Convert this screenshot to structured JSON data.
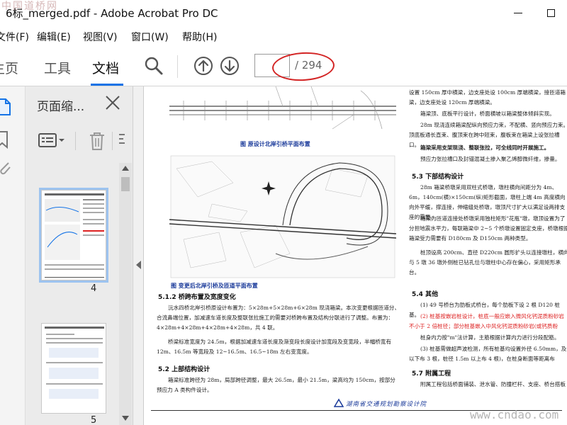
{
  "window": {
    "title": "6标_merged.pdf - Adobe Acrobat Pro DC",
    "watermark_top": "中国道桥网"
  },
  "menu": {
    "items": [
      {
        "label": "文件(F)"
      },
      {
        "label": "编辑(E)"
      },
      {
        "label": "视图(V)"
      },
      {
        "label": "窗口(W)"
      },
      {
        "label": "帮助(H)"
      }
    ]
  },
  "toolbar": {
    "tabs": [
      {
        "label": "主页"
      },
      {
        "label": "工具"
      },
      {
        "label": "文档"
      }
    ],
    "page_input_value": "",
    "page_total": "/ 294"
  },
  "thumbnail_panel": {
    "title": "页面缩...",
    "thumbnails": [
      {
        "label": "4"
      },
      {
        "label": "5"
      }
    ]
  },
  "document": {
    "fig_caption_1": "图  原设计北岸引桥平面布置",
    "fig_caption_2": "图  变更后北岸引桥及匝道平面布置",
    "section_512_heading": "5.1.2 桥跨布置及宽度变化",
    "section_512_p1": "沅水四桥北岸引桥原设计布置为：5×28m+5×28m+6×28m 现浇箱梁。本次变更根据匝道分、合流鼻端位置，加减速车道长度及整联张拉施工的需要对桥跨布置及结构分联进行了调整。布置为：4×28m+4×28m+4×28m+4×28m，共 4 联。",
    "section_512_p2": "桥梁标准宽度为 24.5m，根据加减速车道长度及渐变段长度设计加宽段及变宽段，半幅桥宽有 12m、16.5m 等宽段及 12~16.5m、16.5~18m 左右变宽度。",
    "section_52_heading": "5.2  上部结构设计",
    "section_52_p1": "箱梁标准跨径为 28m，局部跨径调整，最大 26.5m，最小 21.5m，梁高均为 150cm，按部分预应力 A 类构件设计。",
    "right_p1": "设置 150cm 厚中横梁，边支座处设 100cm 厚端横梁，接匝道箱梁，边支座处设 120cm 厚端横梁。",
    "right_p2": "箱梁顶、底板平行设计，桥面横坡以箱梁整体倾斜实现。",
    "right_p3": "28m 现浇连续箱梁配纵向预应力束，不配横、竖向预应力束。顶底板通长直束、腹顶束在跨中短束，腹板束在箱梁上设张拉槽口。",
    "right_p4": "箱梁采用支架现浇、整联张拉，可全线同时开展施工。",
    "right_p5": "预应力张拉槽口及封锚混凝土掺入聚乙烯醇微纤维，掺量。",
    "section_53_heading": "5.3  下部结构设计",
    "right_p6": "28m 箱梁桥墩采用双柱式桥墩，墩柱横向间距分为 4m、6m，140cm(横)×150cm(纵)矩形截面，墩柱上端 4m 高度横向向外平缓，撑连接，伸缩缝处桥墩，墩顶尺寸扩大以满足设两排支座的需要。",
    "right_p7": "箱梁为匝道连接处桥墩采用独柱矩形\"花瓶\"墩，墩顶设置为了分担地震水平力，每联箱梁中 2~5 个桥墩设置固定支座，桥墩根据箱梁受力需要有 D180cm 及 D150cm 两种类型。",
    "right_p8": "桩顶设高 200cm、直径 D220cm 圆形扩头以连接墩柱，横向与 5 墩 36 墩外侧桩已钻孔位与墩柱中心存在偏心，采用矩形承台。",
    "section_54_heading": "5.4  其他",
    "right_p9": "(1) 49 号桥台为肋板式桥台，每个肋板下设 2 根 D120 桩基。",
    "right_p10": "(2) 桩基按嵌岩桩设计，桩底一般应嵌入微风化钙泥质粉砂岩不小于 2 倍桩径；部分桩基嵌入中风化钙泥质粉砂岩(或钙质粉",
    "right_p11": "桩身内力按\"m\"法计算，主筋根据计算内力进行分段配筋。",
    "right_p12": "(3) 桩基需做超声波检测，所有桩基均设置外径 6.50mm，及以下布 3 根，桩径 1.5m 以上布 4 根)，在桩身断面等距离布",
    "section_57_heading": "5.7  附属工程",
    "right_p13": "附属工程包括桥面铺装、泄水管、防撞栏杆、支座、桥台搭板",
    "footer_brand": "湖南省交通规划勘察设计院",
    "watermark_bottom": "www.cndao.com"
  }
}
